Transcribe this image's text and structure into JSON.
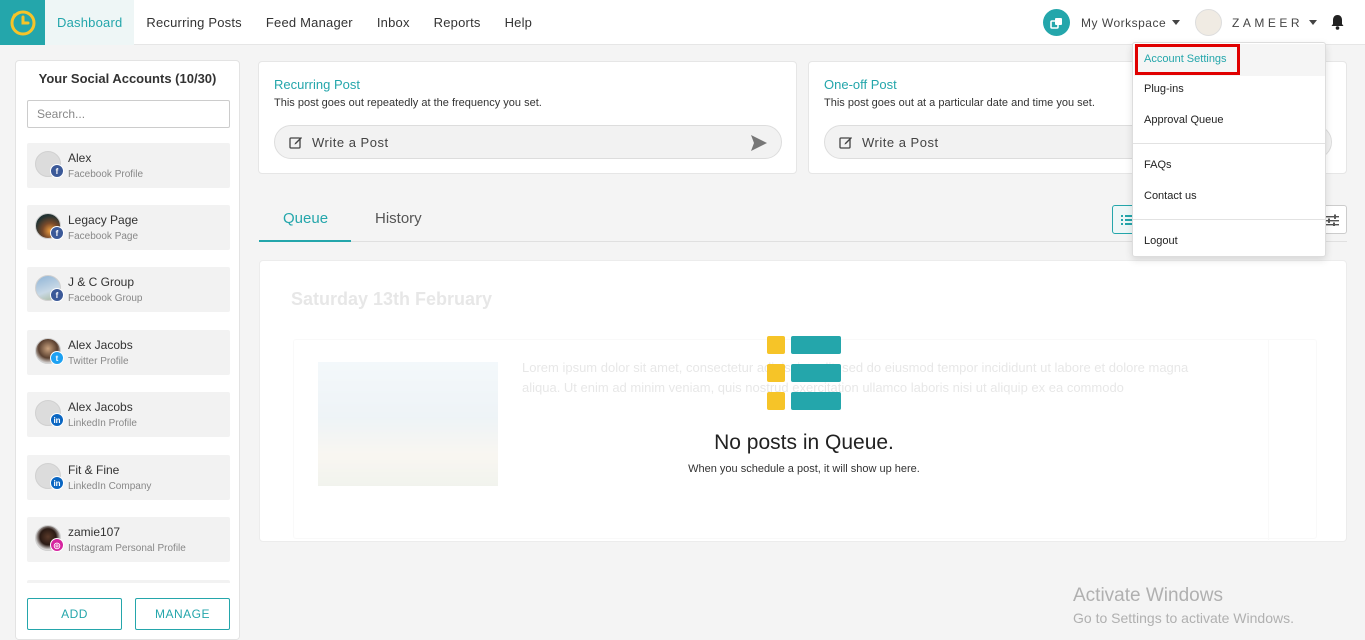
{
  "colors": {
    "accent": "#24a6ab",
    "highlight": "#e00000",
    "facebook": "#3b5998",
    "twitter": "#1da1f2",
    "linkedin": "#0a66c2",
    "instagram": "#d6249f",
    "yellow": "#f6c428"
  },
  "nav": {
    "logo_icon": "clock-logo-icon",
    "items": [
      {
        "label": "Dashboard",
        "active": true
      },
      {
        "label": "Recurring Posts"
      },
      {
        "label": "Feed Manager"
      },
      {
        "label": "Inbox"
      },
      {
        "label": "Reports"
      },
      {
        "label": "Help"
      }
    ],
    "workspace": "My Workspace",
    "user_name": "ZAMEER",
    "notification_icon": "bell-icon"
  },
  "sidebar": {
    "title": "Your Social Accounts (10/30)",
    "search_placeholder": "Search...",
    "accounts": [
      {
        "name": "Alex",
        "type": "Facebook Profile",
        "network": "facebook"
      },
      {
        "name": "Legacy Page",
        "type": "Facebook Page",
        "network": "facebook"
      },
      {
        "name": "J & C Group",
        "type": "Facebook Group",
        "network": "facebook"
      },
      {
        "name": "Alex Jacobs",
        "type": "Twitter Profile",
        "network": "twitter"
      },
      {
        "name": "Alex Jacobs",
        "type": "LinkedIn Profile",
        "network": "linkedin"
      },
      {
        "name": "Fit & Fine",
        "type": "LinkedIn Company",
        "network": "linkedin"
      },
      {
        "name": "zamie107",
        "type": "Instagram Personal Profile",
        "network": "instagram"
      }
    ],
    "add_label": "ADD",
    "manage_label": "MANAGE"
  },
  "composers": [
    {
      "title": "Recurring Post",
      "description": "This post goes out repeatedly at the frequency you set.",
      "write_label": "Write a Post"
    },
    {
      "title": "One-off Post",
      "description": "This post goes out at a particular date and time you set.",
      "write_label": "Write a Post"
    }
  ],
  "tabs": [
    {
      "label": "Queue",
      "active": true
    },
    {
      "label": "History"
    }
  ],
  "queue": {
    "ghost_date": "Saturday 13th February",
    "ghost_text": "Lorem ipsum dolor sit amet, consectetur adipiscing elit, sed do eiusmod tempor incididunt ut labore et dolore magna aliqua. Ut enim ad minim veniam, quis nostrud exercitation ullamco laboris nisi ut aliquip ex ea commodo",
    "empty_title": "No posts in Queue.",
    "empty_subtitle": "When you schedule a post, it will show up here."
  },
  "dropdown": {
    "items": [
      {
        "label": "Account Settings",
        "active": true
      },
      {
        "label": "Plug-ins"
      },
      {
        "label": "Approval Queue"
      },
      {
        "label": "FAQs"
      },
      {
        "label": "Contact us"
      },
      {
        "label": "Logout"
      }
    ]
  },
  "watermark": {
    "title": "Activate Windows",
    "subtitle": "Go to Settings to activate Windows."
  }
}
